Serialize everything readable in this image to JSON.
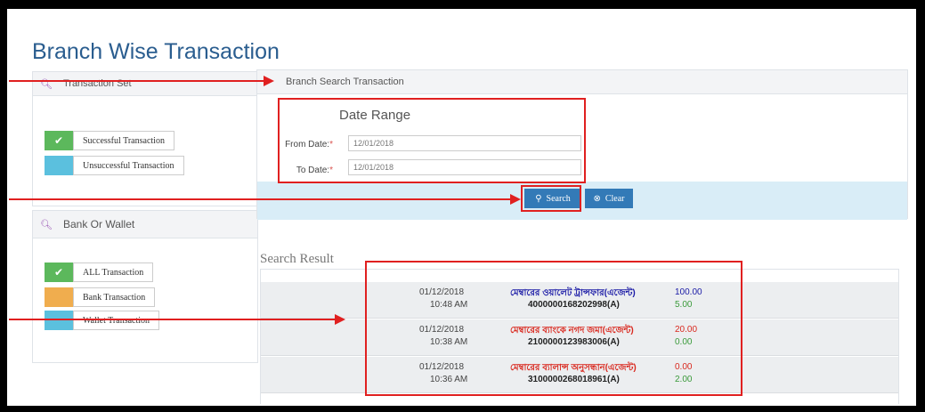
{
  "page_title": "Branch Wise Transaction",
  "transaction_set": {
    "header": "Transaction Set",
    "options": [
      {
        "label": "Successful Transaction",
        "checked": true,
        "color": "#5cb85c"
      },
      {
        "label": "Unsuccessful Transaction",
        "checked": false,
        "color": "#5bc0de"
      }
    ]
  },
  "bank_or_wallet": {
    "header": "Bank Or Wallet",
    "options": [
      {
        "label": "ALL Transaction",
        "checked": true,
        "color": "#5cb85c"
      },
      {
        "label": "Bank Transaction",
        "checked": false,
        "color": "#f0ad4e"
      },
      {
        "label": "Wallet Transaction",
        "checked": false,
        "color": "#5bc0de"
      }
    ]
  },
  "branch_search": {
    "header": "Branch Search Transaction",
    "date_range_title": "Date Range",
    "from_label": "From Date:",
    "from_value": "12/01/2018",
    "to_label": "To Date:",
    "to_value": "12/01/2018",
    "required_mark": "*",
    "search_label": "Search",
    "clear_label": "Clear"
  },
  "search_result": {
    "title": "Search Result",
    "rows": [
      {
        "date": "01/12/2018",
        "time": "10:48 AM",
        "type": "মেম্বারের ওয়ালেট ট্রান্সফার(এজেন্ট)",
        "type_color": "#1a1aa6",
        "account": "4000000168202998(A)",
        "amount": "100.00",
        "amount_color": "#1a1aa6",
        "fee": "5.00"
      },
      {
        "date": "01/12/2018",
        "time": "10:38 AM",
        "type": "মেম্বারের ব্যাংকে নগদ জমা(এজেন্ট)",
        "type_color": "#d9281e",
        "account": "2100000123983006(A)",
        "amount": "20.00",
        "amount_color": "#d9281e",
        "fee": "0.00"
      },
      {
        "date": "01/12/2018",
        "time": "10:36 AM",
        "type": "মেম্বারের ব্যালান্স অনুসন্ধান(এজেন্ট)",
        "type_color": "#d9281e",
        "account": "3100000268018961(A)",
        "amount": "0.00",
        "amount_color": "#d9281e",
        "fee": "2.00"
      }
    ]
  }
}
